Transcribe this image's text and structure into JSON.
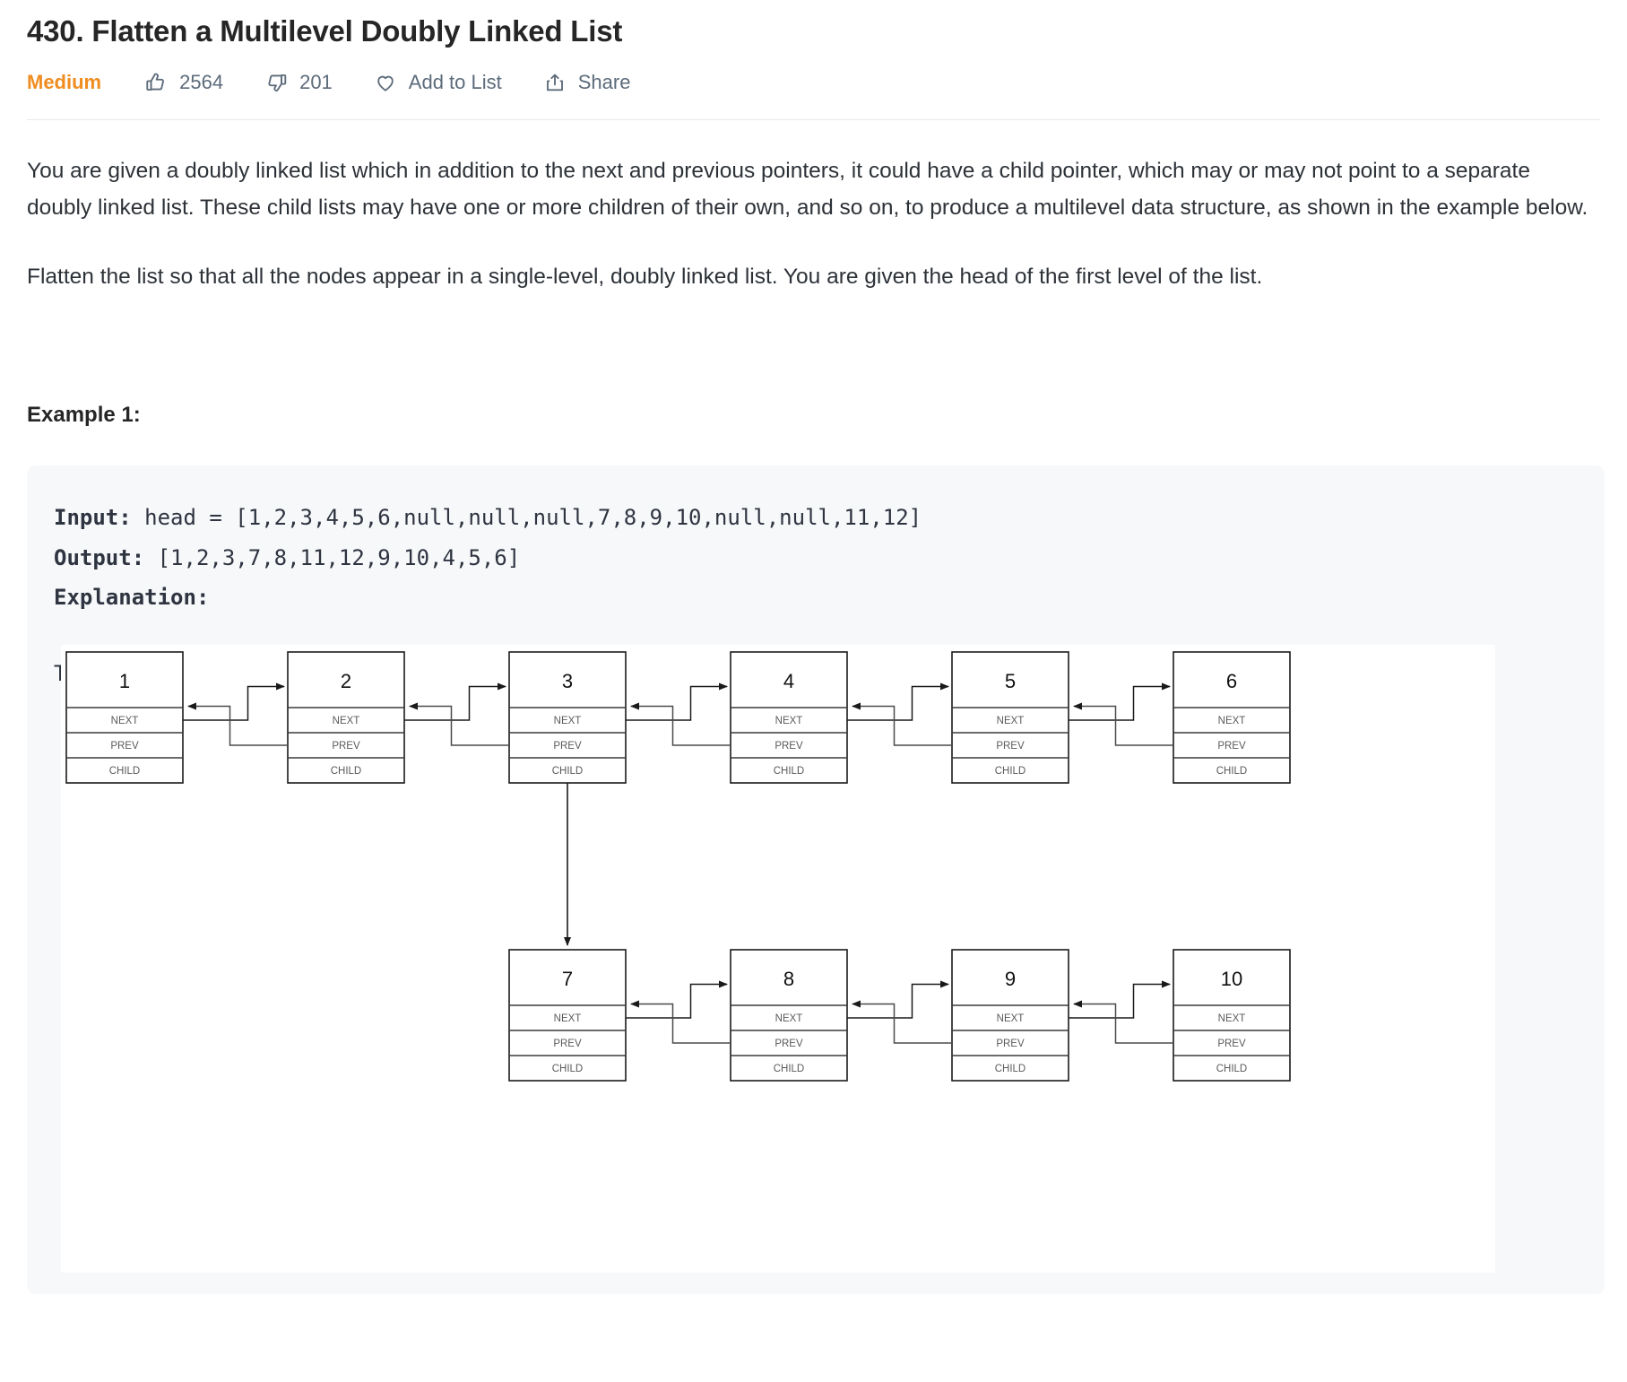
{
  "header": {
    "title": "430. Flatten a Multilevel Doubly Linked List",
    "difficulty": "Medium",
    "likes": "2564",
    "dislikes": "201",
    "add_to_list": "Add to List",
    "share": "Share",
    "accent_color": "#ef8d21"
  },
  "description": {
    "paragraph1": "You are given a doubly linked list which in addition to the next and previous pointers, it could have a child pointer, which may or may not point to a separate doubly linked list. These child lists may have one or more children of their own, and so on, to produce a multilevel data structure, as shown in the example below.",
    "paragraph2": "Flatten the list so that all the nodes appear in a single-level, doubly linked list. You are given the head of the first level of the list."
  },
  "example": {
    "heading": "Example 1:",
    "input_label": "Input:",
    "input_value": " head = [1,2,3,4,5,6,null,null,null,7,8,9,10,null,null,11,12]",
    "output_label": "Output:",
    "output_value": " [1,2,3,7,8,11,12,9,10,4,5,6]",
    "explanation_label": "Explanation:",
    "explanation_text": "The multilevel linked list in the input is as follows:"
  },
  "diagram": {
    "field_labels": {
      "next": "NEXT",
      "prev": "PREV",
      "child": "CHILD"
    },
    "level1": [
      {
        "value": "1",
        "fields": [
          "NEXT",
          "PREV",
          "CHILD"
        ]
      },
      {
        "value": "2",
        "fields": [
          "NEXT",
          "PREV",
          "CHILD"
        ]
      },
      {
        "value": "3",
        "fields": [
          "NEXT",
          "PREV",
          "CHILD"
        ],
        "has_child_link": true
      },
      {
        "value": "4",
        "fields": [
          "NEXT",
          "PREV",
          "CHILD"
        ]
      },
      {
        "value": "5",
        "fields": [
          "NEXT",
          "PREV",
          "CHILD"
        ]
      },
      {
        "value": "6",
        "fields": [
          "NEXT",
          "PREV",
          "CHILD"
        ]
      }
    ],
    "level2": [
      {
        "value": "7",
        "fields": [
          "NEXT",
          "PREV",
          "CHILD"
        ]
      },
      {
        "value": "8",
        "fields": [
          "NEXT",
          "PREV",
          "CHILD"
        ]
      },
      {
        "value": "9",
        "fields": [
          "NEXT",
          "PREV",
          "CHILD"
        ]
      },
      {
        "value": "10",
        "fields": [
          "NEXT",
          "PREV",
          "CHILD"
        ]
      }
    ]
  }
}
